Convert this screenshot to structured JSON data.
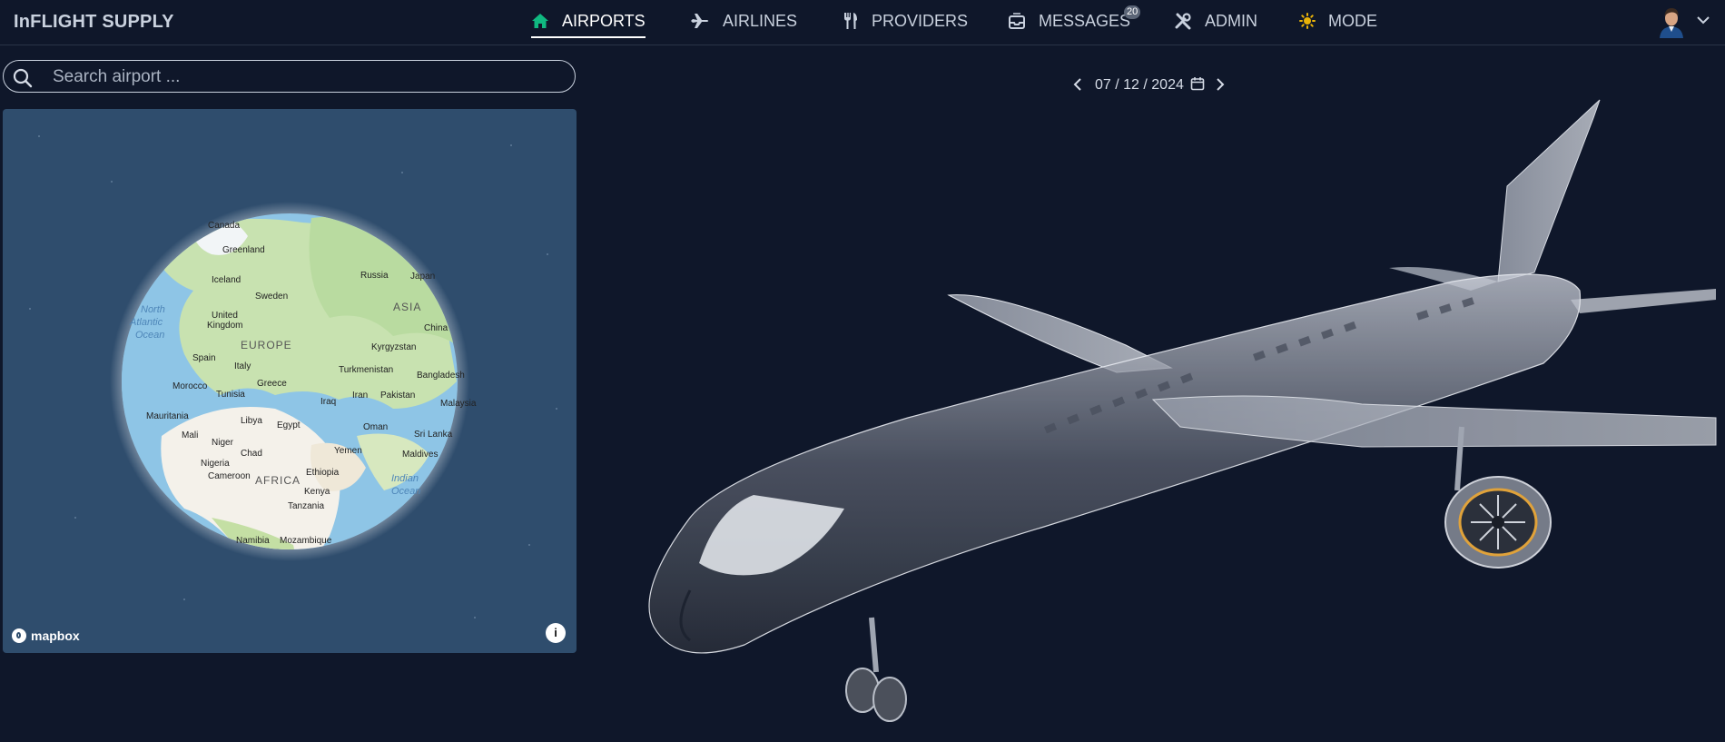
{
  "app": {
    "brand": "InFLIGHT SUPPLY"
  },
  "nav": {
    "items": [
      {
        "label": "AIRPORTS",
        "icon": "home-icon",
        "active": true
      },
      {
        "label": "AIRLINES",
        "icon": "airplane-icon",
        "active": false
      },
      {
        "label": "PROVIDERS",
        "icon": "utensils-icon",
        "active": false
      },
      {
        "label": "MESSAGES",
        "icon": "inbox-icon",
        "active": false,
        "badge": "20"
      },
      {
        "label": "ADMIN",
        "icon": "tools-icon",
        "active": false
      },
      {
        "label": "MODE",
        "icon": "sun-icon",
        "active": false
      }
    ]
  },
  "user": {
    "avatar": "user-avatar",
    "menu_icon": "chevron-down-icon"
  },
  "search": {
    "placeholder": "Search airport ...",
    "value": ""
  },
  "map": {
    "attribution": "mapbox",
    "info_icon": "info-icon",
    "labels": {
      "canada": "Canada",
      "greenland": "Greenland",
      "russia": "Russia",
      "japan": "Japan",
      "iceland": "Iceland",
      "sweden": "Sweden",
      "asia": "ASIA",
      "north_atlantic": [
        "North",
        "Atlantic",
        "Ocean"
      ],
      "uk": [
        "United",
        "Kingdom"
      ],
      "europe": "EUROPE",
      "china": "China",
      "kyrgyzstan": "Kyrgyzstan",
      "spain": "Spain",
      "italy": "Italy",
      "turkmenistan": "Turkmenistan",
      "bangladesh": "Bangladesh",
      "morocco": "Morocco",
      "greece": "Greece",
      "tunisia": "Tunisia",
      "iraq": "Iraq",
      "iran": "Iran",
      "pakistan": "Pakistan",
      "malaysia": "Malaysia",
      "mauritania": "Mauritania",
      "libya": "Libya",
      "egypt": "Egypt",
      "oman": "Oman",
      "mali": "Mali",
      "niger": "Niger",
      "sri_lanka": "Sri Lanka",
      "yemen": "Yemen",
      "chad": "Chad",
      "maldives": "Maldives",
      "nigeria": "Nigeria",
      "ethiopia": "Ethiopia",
      "cameroon": "Cameroon",
      "africa": "AFRICA",
      "indian_ocean": [
        "Indian",
        "Ocean"
      ],
      "kenya": "Kenya",
      "tanzania": "Tanzania",
      "namibia": "Namibia",
      "mozambique": "Mozambique"
    }
  },
  "date": {
    "value": "07 / 12 / 2024"
  },
  "colors": {
    "background": "#0f172a",
    "accent_green": "#10b981",
    "mode_yellow": "#eab308",
    "map_ocean": "#2f4d6d"
  }
}
